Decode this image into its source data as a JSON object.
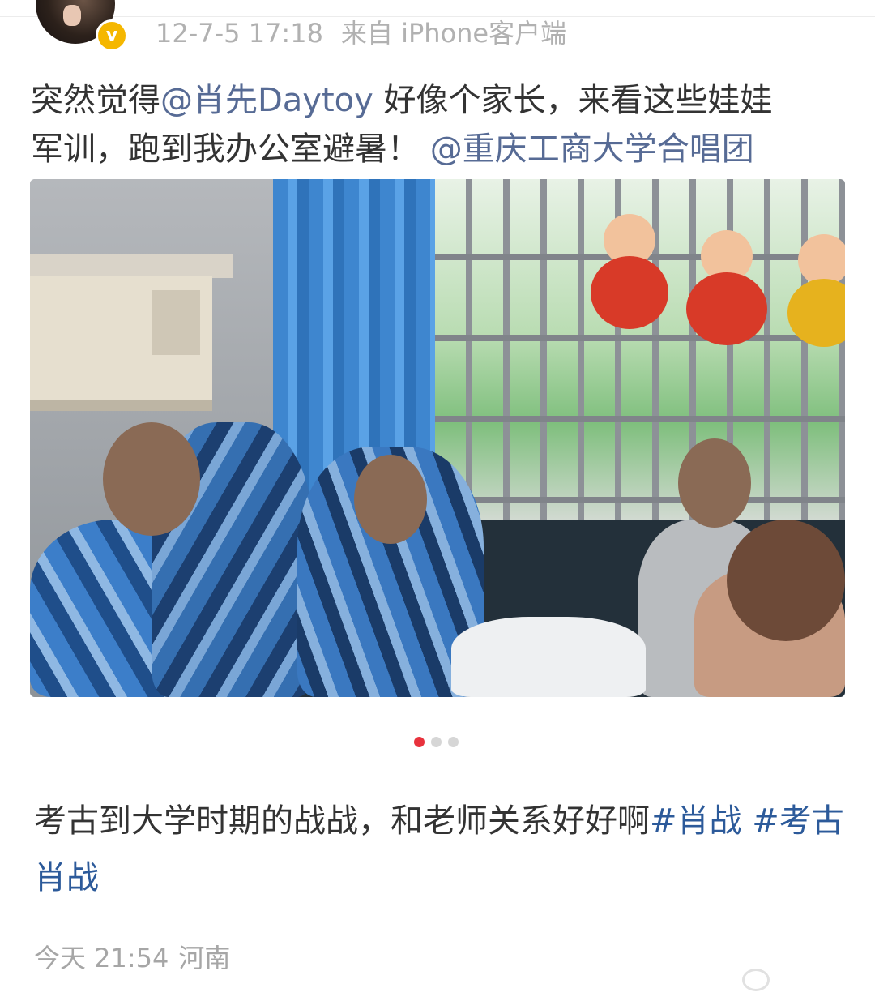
{
  "post": {
    "meta": {
      "date": "12-7-5 17:18",
      "source": "来自 iPhone客户端"
    },
    "text": {
      "part1": "突然觉得",
      "mention1": "@肖先Daytoy",
      "part2": " 好像个家长，来看这些娃娃",
      "part3": "军训，跑到我办公室避暑！",
      "mention2": "@重庆工商大学合唱团"
    },
    "verified_badge": "v"
  },
  "carousel": {
    "total": 3,
    "active_index": 1
  },
  "caption": {
    "text": "考古到大学时期的战战，和老师关系好好啊",
    "tag1": "#肖战",
    "tag2": "#考古肖战"
  },
  "footer": {
    "time": "今天 21:54",
    "location": "河南"
  },
  "colors": {
    "mention": "#576b95",
    "tag": "#2c5a9a",
    "active_dot": "#e8323d",
    "badge": "#f5b700"
  }
}
